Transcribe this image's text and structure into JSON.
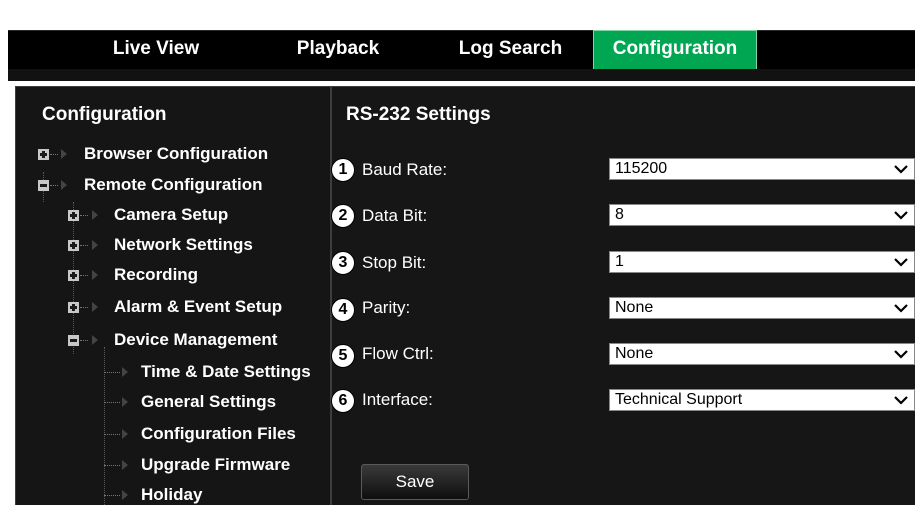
{
  "tabs": [
    {
      "label": "Live View"
    },
    {
      "label": "Playback"
    },
    {
      "label": "Log Search"
    },
    {
      "label": "Configuration",
      "active": true
    }
  ],
  "sidebar": {
    "title": "Configuration",
    "items": [
      {
        "label": "Browser Configuration",
        "bold": true,
        "expander": "plus"
      },
      {
        "label": "Remote Configuration",
        "bold": true,
        "expander": "minus"
      },
      {
        "label": "Camera Setup",
        "bold": true,
        "expander": "plus"
      },
      {
        "label": "Network Settings",
        "bold": true,
        "expander": "plus"
      },
      {
        "label": "Recording",
        "bold": true,
        "expander": "plus"
      },
      {
        "label": "Alarm & Event Setup",
        "bold": true,
        "expander": "plus"
      },
      {
        "label": "Device Management",
        "bold": true,
        "expander": "minus"
      },
      {
        "label": "Time & Date Settings",
        "bold": true
      },
      {
        "label": "General Settings",
        "bold": true
      },
      {
        "label": "Configuration Files",
        "bold": true
      },
      {
        "label": "Upgrade Firmware",
        "bold": true
      },
      {
        "label": "Holiday",
        "bold": true
      }
    ]
  },
  "main": {
    "title": "RS-232 Settings",
    "fields": [
      {
        "num": "1",
        "label": "Baud Rate:",
        "value": "115200"
      },
      {
        "num": "2",
        "label": "Data Bit:",
        "value": "8"
      },
      {
        "num": "3",
        "label": "Stop Bit:",
        "value": "1"
      },
      {
        "num": "4",
        "label": "Parity:",
        "value": "None"
      },
      {
        "num": "5",
        "label": "Flow Ctrl:",
        "value": "None"
      },
      {
        "num": "6",
        "label": "Interface:",
        "value": "Technical Support"
      }
    ],
    "save_label": "Save"
  },
  "colors": {
    "active_tab": "#00a651",
    "panel_bg": "#151515",
    "bar_bg": "#000000"
  },
  "icons": {
    "expander_plus": "plus-box-icon",
    "expander_minus": "minus-box-icon",
    "tree_arrow": "triangle-right-icon",
    "select_arrow": "chevron-down-icon"
  }
}
